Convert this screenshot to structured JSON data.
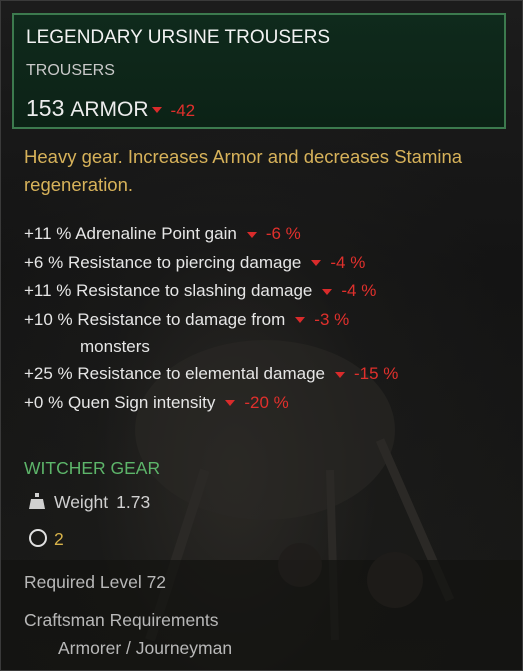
{
  "item": {
    "name": "LEGENDARY URSINE TROUSERS",
    "type": "TROUSERS",
    "armor": {
      "value": "153",
      "label": "ARMOR",
      "delta": "-42"
    },
    "description": "Heavy gear. Increases Armor and decreases Stamina regeneration.",
    "attributes": [
      {
        "text": "+11 % Adrenaline Point gain",
        "cont": "",
        "delta": "-6 %"
      },
      {
        "text": "+6 % Resistance to piercing damage",
        "cont": "",
        "delta": "-4 %"
      },
      {
        "text": "+11 % Resistance to slashing damage",
        "cont": "",
        "delta": "-4 %"
      },
      {
        "text": "+10 % Resistance to damage from",
        "cont": "monsters",
        "delta": "-3 %"
      },
      {
        "text": "+25 % Resistance to elemental damage",
        "cont": "",
        "delta": "-15 %"
      },
      {
        "text": "+0 % Quen Sign intensity",
        "cont": "",
        "delta": "-20 %"
      }
    ],
    "gear_set": "WITCHER GEAR",
    "weight_label": "Weight",
    "weight_value": "1.73",
    "slots": "2",
    "required_level": "Required Level 72",
    "craftsman_title": "Craftsman Requirements",
    "craftsman_value": "Armorer / Journeyman"
  },
  "colors": {
    "header_border": "#3c7a4e",
    "header_bg": "#0f2a1c",
    "description": "#d7b25a",
    "negative": "#e0302c",
    "gear_set": "#5db56a",
    "slots": "#d8b34a"
  },
  "icons": {
    "armor_change": "down-triangle-icon",
    "weight": "weight-icon",
    "slot": "empty-slot-circle-icon"
  }
}
